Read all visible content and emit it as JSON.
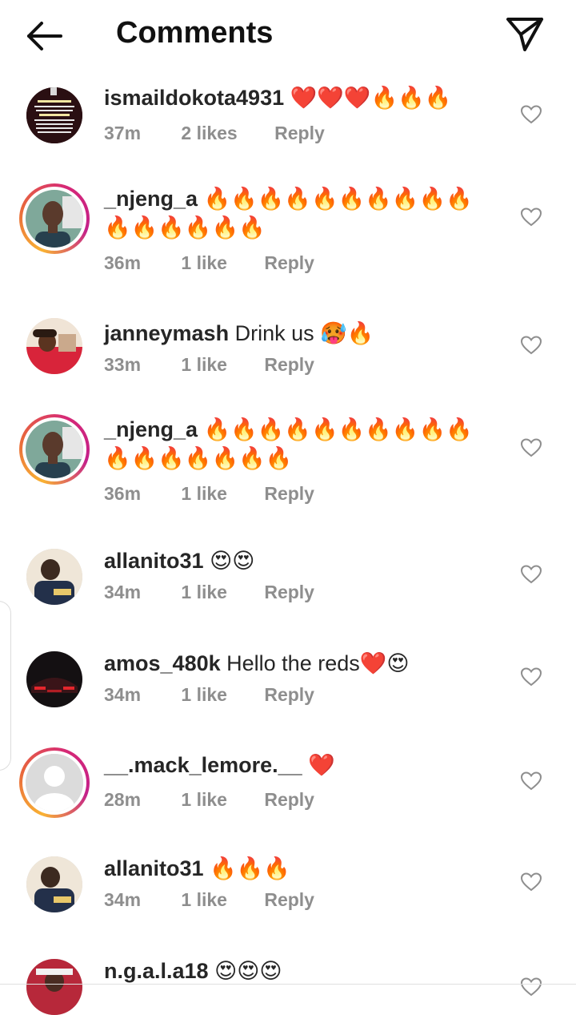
{
  "header": {
    "title": "Comments",
    "back_icon": "arrow-left-icon",
    "share_icon": "send-paper-plane-icon"
  },
  "colors": {
    "username": "#262626",
    "meta": "#8e8e8e",
    "story_ring_start": "#f9b233",
    "story_ring_end": "#d62976"
  },
  "comments": [
    {
      "username": "ismaildokota4931",
      "text": "❤️❤️❤️🔥🔥🔥",
      "time": "37m",
      "likes": "2 likes",
      "reply": "Reply",
      "avatar_ring": false,
      "avatar_text": "Don't feel bad if people remember you only when they need you. Feel privileged that you are like a candle that comes to their mind when there is darkness"
    },
    {
      "username": "_njeng_a",
      "text": "🔥🔥🔥🔥🔥🔥🔥🔥🔥🔥🔥🔥🔥🔥🔥🔥",
      "time": "36m",
      "likes": "1 like",
      "reply": "Reply",
      "avatar_ring": true
    },
    {
      "username": "janneymash",
      "text": "Drink us 🥵🔥",
      "time": "33m",
      "likes": "1 like",
      "reply": "Reply",
      "avatar_ring": false
    },
    {
      "username": "_njeng_a",
      "text": "🔥🔥🔥🔥🔥🔥🔥🔥🔥🔥🔥🔥🔥🔥🔥🔥🔥",
      "time": "36m",
      "likes": "1 like",
      "reply": "Reply",
      "avatar_ring": true
    },
    {
      "username": "allanito31",
      "text": "😍😍",
      "time": "34m",
      "likes": "1 like",
      "reply": "Reply",
      "avatar_ring": false
    },
    {
      "username": "amos_480k",
      "text": "Hello the reds❤️😍",
      "time": "34m",
      "likes": "1 like",
      "reply": "Reply",
      "avatar_ring": false
    },
    {
      "username": "__.mack_lemore.__",
      "text": "❤️",
      "time": "28m",
      "likes": "1 like",
      "reply": "Reply",
      "avatar_ring": true
    },
    {
      "username": "allanito31",
      "text": "🔥🔥🔥",
      "time": "34m",
      "likes": "1 like",
      "reply": "Reply",
      "avatar_ring": false
    },
    {
      "username": "n.g.a.l.a18",
      "text": "😍😍😍",
      "time": "",
      "likes": "",
      "reply": "",
      "avatar_ring": false
    }
  ]
}
